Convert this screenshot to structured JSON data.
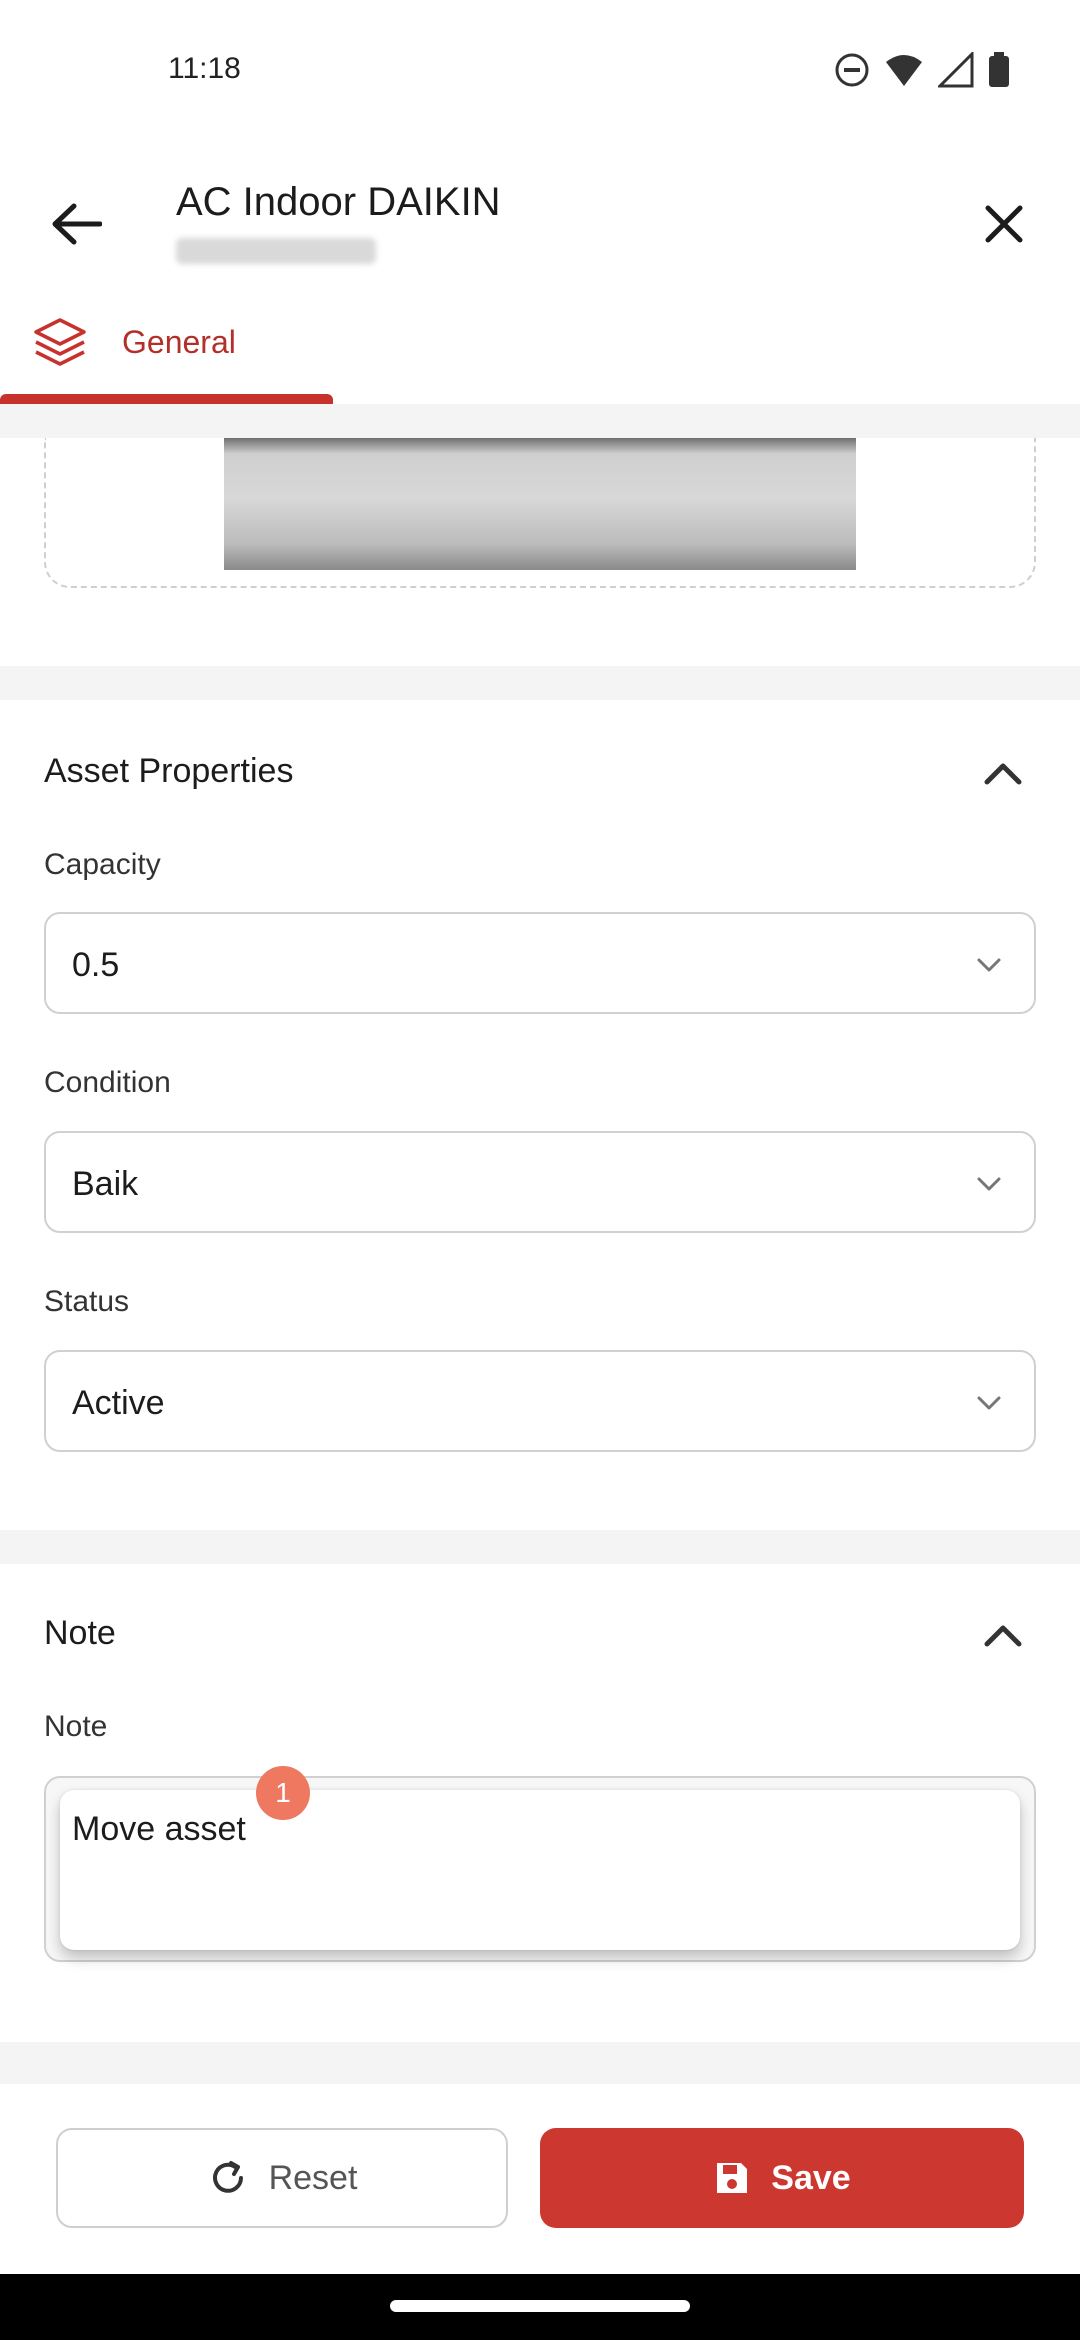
{
  "status_bar": {
    "time": "11:18"
  },
  "app_bar": {
    "title": "AC Indoor DAIKIN"
  },
  "tabs": [
    {
      "label": "General",
      "icon": "layers-icon",
      "active": true
    }
  ],
  "colors": {
    "accent": "#c8322d",
    "badge": "#ef7860"
  },
  "asset_properties": {
    "title": "Asset Properties",
    "fields": [
      {
        "label": "Capacity",
        "value": "0.5"
      },
      {
        "label": "Condition",
        "value": "Baik"
      },
      {
        "label": "Status",
        "value": "Active"
      }
    ]
  },
  "note_section": {
    "title": "Note",
    "field_label": "Note",
    "value": "Move asset",
    "badge": "1"
  },
  "actions": {
    "reset_label": "Reset",
    "save_label": "Save"
  }
}
